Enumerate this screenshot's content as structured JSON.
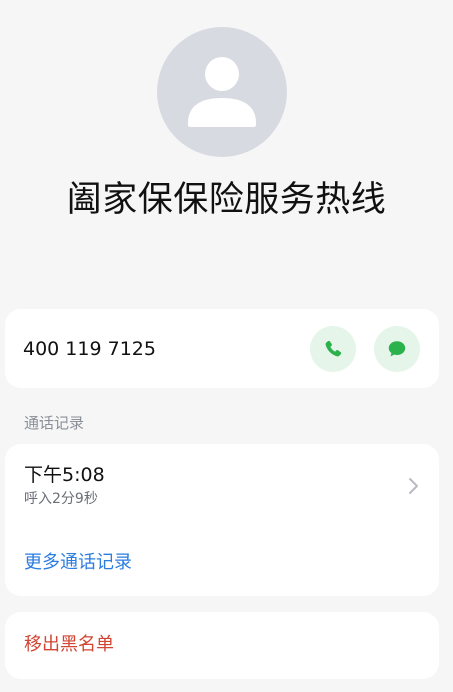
{
  "contact": {
    "name": "阖家保保险服务热线",
    "avatar_icon": "person-icon",
    "number": "400 119 7125"
  },
  "actions": {
    "call_icon": "phone-icon",
    "message_icon": "message-icon",
    "accent_color": "#2bb24c"
  },
  "history": {
    "section_label": "通话记录",
    "entries": [
      {
        "time": "下午5:08",
        "detail": "呼入2分9秒"
      }
    ],
    "more_label": "更多通话记录"
  },
  "blacklist": {
    "remove_label": "移出黑名单"
  }
}
